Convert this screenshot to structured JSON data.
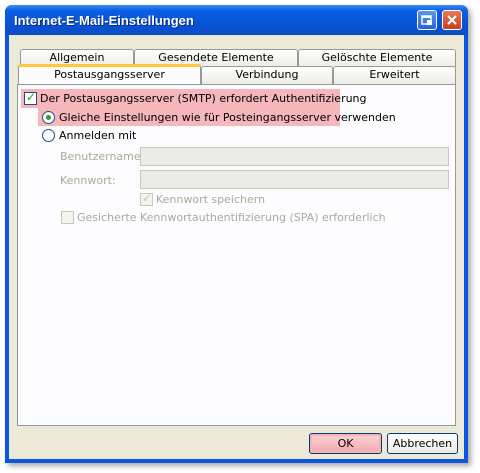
{
  "window": {
    "title": "Internet-E-Mail-Einstellungen"
  },
  "tabs_row1": [
    {
      "label": "Allgemein"
    },
    {
      "label": "Gesendete Elemente"
    },
    {
      "label": "Gelöschte Elemente"
    }
  ],
  "tabs_row2": [
    {
      "label": "Postausgangsserver",
      "selected": true
    },
    {
      "label": "Verbindung"
    },
    {
      "label": "Erweitert"
    }
  ],
  "smtp_auth": {
    "label": "Der Postausgangsserver (SMTP) erfordert Authentifizierung",
    "checked": true
  },
  "options": {
    "same_settings_label": "Gleiche Einstellungen wie für Posteingangsserver verwenden",
    "login_label": "Anmelden mit",
    "selected": "same_settings"
  },
  "credentials": {
    "username_label": "Benutzername:",
    "username_value": "",
    "password_label": "Kennwort:",
    "password_value": "",
    "save_password_label": "Kennwort speichern",
    "spa_label": "Gesicherte Kennwortauthentifizierung (SPA) erforderlich"
  },
  "buttons": {
    "ok": "OK",
    "cancel": "Abbrechen"
  },
  "colors": {
    "highlight": "#f5b7bc",
    "title_bar": "#0a56dc",
    "dialog_bg": "#ece9d8"
  }
}
